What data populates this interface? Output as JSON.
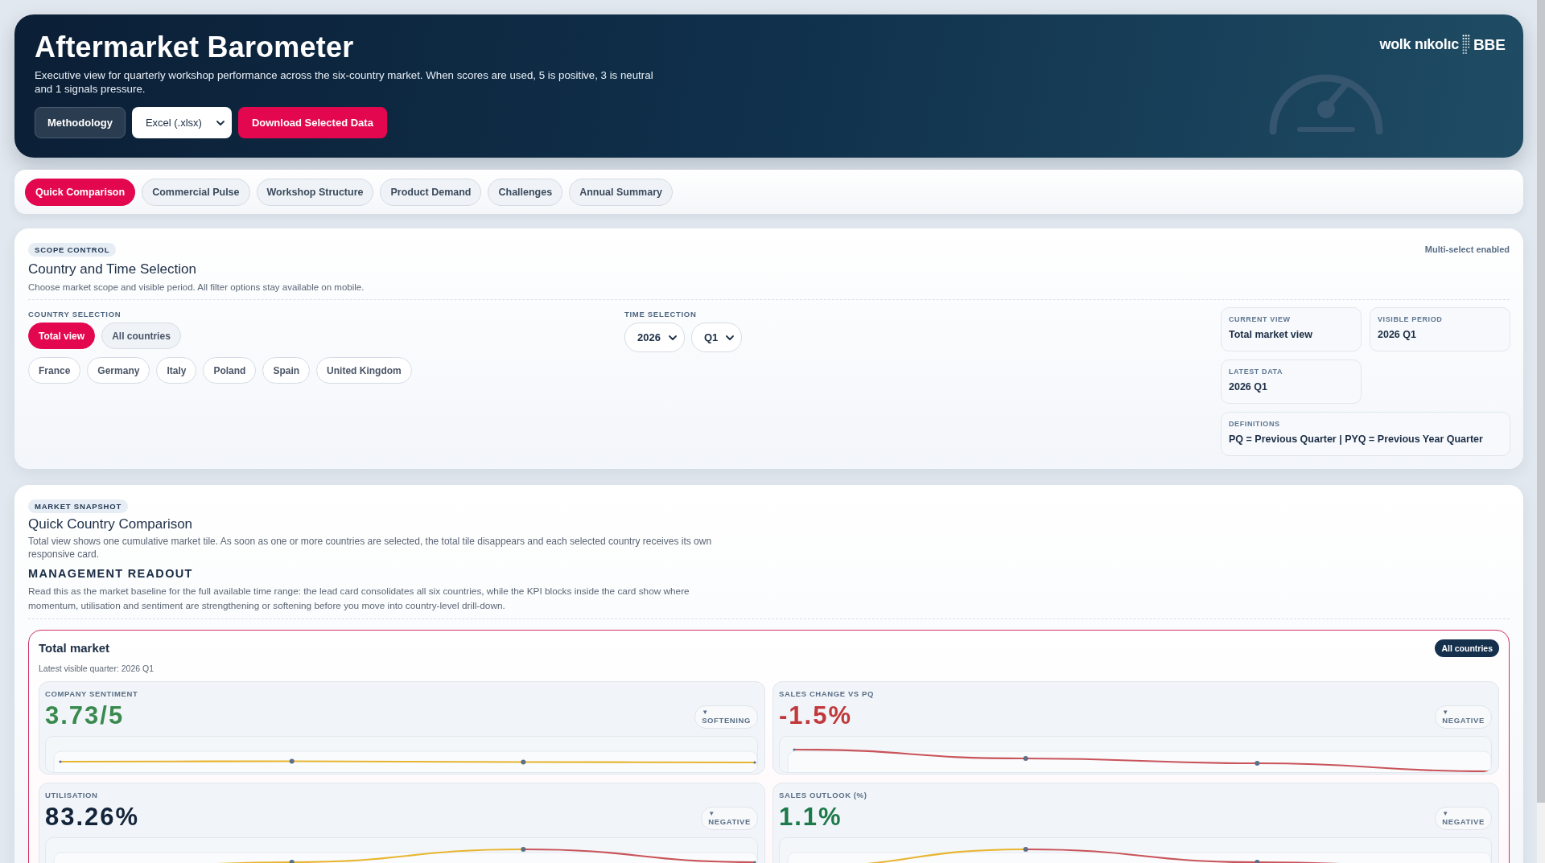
{
  "header": {
    "title": "Aftermarket Barometer",
    "description": "Executive view for quarterly workshop performance across the six-country market. When scores are used, 5 is positive, 3 is neutral and 1 signals pressure.",
    "methodology_button": "Methodology",
    "export_format": {
      "value": "Excel (.xlsx)"
    },
    "download_button": "Download Selected Data",
    "logo": {
      "wordmark": "wolk nıkolıc",
      "brand": "BBE"
    }
  },
  "tabs": [
    {
      "label": "Quick Comparison",
      "selected": true
    },
    {
      "label": "Commercial Pulse",
      "selected": false
    },
    {
      "label": "Workshop Structure",
      "selected": false
    },
    {
      "label": "Product Demand",
      "selected": false
    },
    {
      "label": "Challenges",
      "selected": false
    },
    {
      "label": "Annual Summary",
      "selected": false
    }
  ],
  "scope_control": {
    "badge": "SCOPE CONTROL",
    "note": "Multi-select enabled",
    "title": "Country and Time Selection",
    "subtitle": "Choose market scope and visible period. All filter options stay available on mobile.",
    "country_selection": {
      "label": "COUNTRY SELECTION",
      "scope_options": [
        {
          "label": "Total view",
          "selected": true
        },
        {
          "label": "All countries",
          "selected": false
        }
      ],
      "countries": [
        {
          "label": "France",
          "selected": false
        },
        {
          "label": "Germany",
          "selected": false
        },
        {
          "label": "Italy",
          "selected": false
        },
        {
          "label": "Poland",
          "selected": false
        },
        {
          "label": "Spain",
          "selected": false
        },
        {
          "label": "United Kingdom",
          "selected": false
        }
      ]
    },
    "time_selection": {
      "label": "TIME SELECTION",
      "year": "2026",
      "quarter": "Q1"
    },
    "info_cards": [
      {
        "label": "CURRENT VIEW",
        "value": "Total market view"
      },
      {
        "label": "VISIBLE PERIOD",
        "value": "2026 Q1"
      },
      {
        "label": "LATEST DATA",
        "value": "2026 Q1"
      }
    ],
    "definitions": {
      "label": "DEFINITIONS",
      "value": "PQ = Previous Quarter | PYQ = Previous Year Quarter"
    }
  },
  "market_snapshot": {
    "badge": "MARKET SNAPSHOT",
    "title": "Quick Country Comparison",
    "description": "Total view shows one cumulative market tile. As soon as one or more countries are selected, the total tile disappears and each selected country receives its own responsive card.",
    "readout_heading": "MANAGEMENT READOUT",
    "readout_text": "Read this as the market baseline for the full available time range: the lead card consolidates all six countries, while the KPI blocks inside the card show where momentum, utilisation and sentiment are strengthening or softening before you move into country-level drill-down.",
    "total_card": {
      "title": "Total market",
      "badge": "All countries",
      "subtitle": "Latest visible quarter: 2026 Q1",
      "kpis": [
        {
          "kind": "steady",
          "label": "COMPANY SENTIMENT",
          "value": "3.73/5",
          "color": "#3a8a4f",
          "trend": {
            "arrow": "▼",
            "label": "SOFTENING"
          }
        },
        {
          "kind": "falling",
          "label": "SALES CHANGE VS PQ",
          "value": "-1.5%",
          "color": "#c0393b",
          "trend": {
            "arrow": "▼",
            "label": "NEGATIVE"
          }
        },
        {
          "kind": "latepeak",
          "label": "UTILISATION",
          "value": "83.26%",
          "color": "#13243a",
          "trend": {
            "arrow": "▼",
            "label": "NEGATIVE"
          }
        },
        {
          "kind": "earlypeak",
          "label": "SALES OUTLOOK (%)",
          "value": "1.1%",
          "color": "#1d7a4b",
          "trend": {
            "arrow": "▼",
            "label": "NEGATIVE"
          }
        }
      ]
    }
  }
}
